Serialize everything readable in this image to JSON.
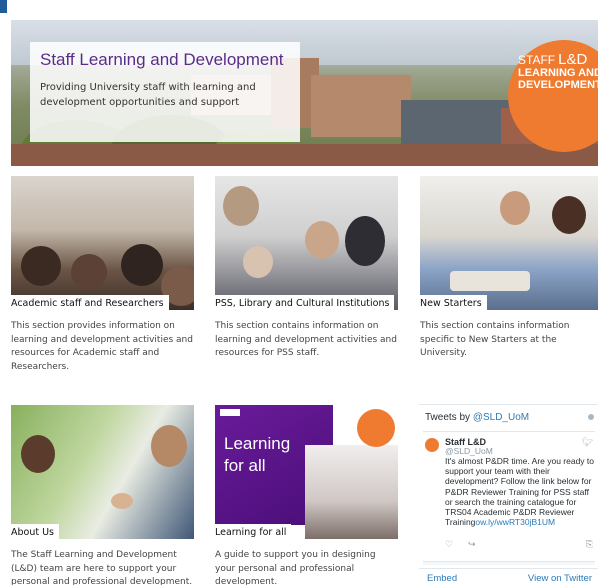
{
  "hero": {
    "title": "Staff Learning and Development",
    "subtitle": "Providing University staff with learning and development opportunities and support",
    "badge": {
      "line1": "STAFF",
      "line2": "L&D",
      "line3": "LEARNING AND",
      "line4": "DEVELOPMENT"
    }
  },
  "cards": [
    {
      "caption": "Academic staff and Researchers",
      "description": "This section provides information on learning and development activities and resources for Academic staff and Researchers."
    },
    {
      "caption": "PSS, Library and Cultural Institutions",
      "description": "This section contains information on learning and development activities and resources for PSS staff."
    },
    {
      "caption": "New Starters",
      "description": "This section contains information specific to New Starters at the University."
    },
    {
      "caption": "About Us",
      "description": "The Staff Learning and Development (L&D) team are here to support your personal and professional development."
    },
    {
      "caption": "Learning for all",
      "description": "A guide to support you in designing your personal and professional development.",
      "image_text": "Learning for all"
    }
  ],
  "twitter": {
    "header_prefix": "Tweets by",
    "header_handle": "@SLD_UoM",
    "tweet": {
      "name": "Staff L&D",
      "handle": "@SLD_UoM",
      "text": "It's almost P&DR time. Are you ready to support your team with their development? Follow the link below for P&DR Reviewer Training for PSS staff or search the training catalogue for TRS04 Academic P&DR Reviewer Training",
      "link": "ow.ly/wwRT30jB1UM"
    },
    "embed_label": "Embed",
    "view_label": "View on Twitter"
  },
  "colors": {
    "accent": "#5b2c87",
    "badge": "#ef7b31",
    "link": "#2b7bb9"
  }
}
